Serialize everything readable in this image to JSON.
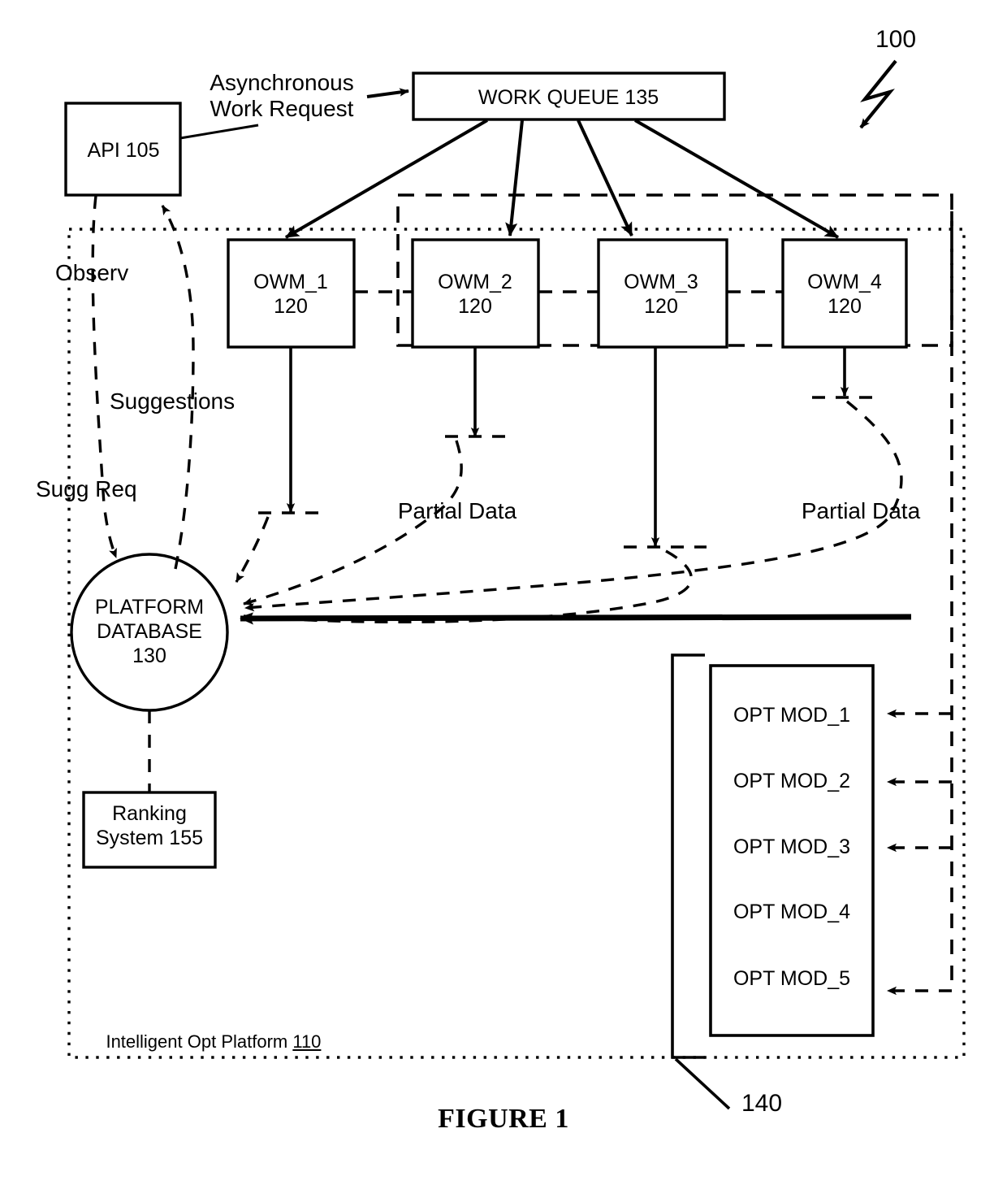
{
  "figure": {
    "caption": "FIGURE 1",
    "system_ref": "100",
    "opt_modules_group_ref": "140"
  },
  "nodes": {
    "api": {
      "label": "API 105"
    },
    "work_queue": {
      "label": "WORK QUEUE 135"
    },
    "platform_database": {
      "line1": "PLATFORM",
      "line2": "DATABASE",
      "line3": "130"
    },
    "ranking_system": {
      "line1": "Ranking",
      "line2": "System 155"
    },
    "platform_boundary": {
      "label": "Intelligent Opt Platform ",
      "ref": "110"
    },
    "owm": [
      {
        "name": "OWM_1",
        "ref": "120"
      },
      {
        "name": "OWM_2",
        "ref": "120"
      },
      {
        "name": "OWM_3",
        "ref": "120"
      },
      {
        "name": "OWM_4",
        "ref": "120"
      }
    ],
    "opt_modules": [
      {
        "label": "OPT MOD_1"
      },
      {
        "label": "OPT MOD_2"
      },
      {
        "label": "OPT MOD_3"
      },
      {
        "label": "OPT MOD_4"
      },
      {
        "label": "OPT MOD_5"
      }
    ]
  },
  "edge_labels": {
    "async_work_request_line1": "Asynchronous",
    "async_work_request_line2": "Work Request",
    "observ": "Observ",
    "suggestions": "Suggestions",
    "sugg_req": "Sugg Req",
    "partial_data_left": "Partial Data",
    "partial_data_right": "Partial Data"
  },
  "colors": {
    "ink": "#000000",
    "paper": "#ffffff"
  }
}
